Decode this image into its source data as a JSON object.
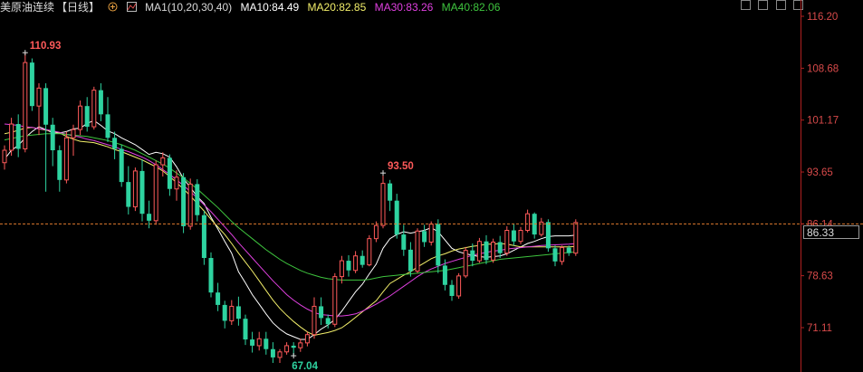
{
  "legend": {
    "title": "美原油连续",
    "period": "【日线】",
    "ma_name": "MA1(10,20,30,40)",
    "ma10": "MA10:84.49",
    "ma20": "MA20:82.85",
    "ma30": "MA30:83.26",
    "ma40": "MA40:82.06"
  },
  "price_box": "86.33",
  "colors": {
    "background": "#000000",
    "up": "#ff5a5a",
    "down": "#2ed3a0",
    "ma10": "#ffffff",
    "ma20": "#f2ee6a",
    "ma30": "#e040e0",
    "ma40": "#3ec43e",
    "axis_text": "#d84a4a",
    "last_price_line": "#e07a2e"
  },
  "chart_data": {
    "type": "candlestick",
    "y_ticks": [
      "116.20",
      "108.68",
      "101.17",
      "93.65",
      "86.14",
      "78.63",
      "71.11"
    ],
    "ylim": [
      63.5,
      116.2
    ],
    "annotations": [
      {
        "text": "110.93",
        "value": 110.93,
        "index": 3
      },
      {
        "text": "93.50",
        "value": 93.5,
        "index": 55
      },
      {
        "text": "67.04",
        "value": 67.04,
        "index": 42
      }
    ],
    "last_price": 86.33,
    "candles": [
      [
        95.0,
        97.5,
        94.0,
        96.8
      ],
      [
        96.8,
        101.5,
        96.0,
        100.6
      ],
      [
        100.6,
        102.0,
        95.8,
        97.0
      ],
      [
        97.0,
        110.93,
        96.5,
        109.5
      ],
      [
        109.5,
        110.1,
        102.5,
        103.2
      ],
      [
        103.2,
        106.5,
        99.0,
        105.8
      ],
      [
        105.8,
        106.5,
        90.8,
        100.5
      ],
      [
        100.5,
        101.5,
        94.5,
        96.8
      ],
      [
        96.8,
        97.5,
        90.8,
        92.5
      ],
      [
        92.5,
        99.5,
        92.0,
        98.6
      ],
      [
        98.6,
        100.5,
        96.0,
        99.8
      ],
      [
        99.8,
        104.0,
        99.0,
        103.2
      ],
      [
        103.2,
        104.5,
        99.5,
        100.2
      ],
      [
        100.2,
        106.0,
        99.8,
        105.5
      ],
      [
        105.5,
        106.5,
        101.0,
        102.0
      ],
      [
        102.0,
        104.5,
        98.0,
        98.6
      ],
      [
        98.6,
        99.5,
        95.5,
        97.0
      ],
      [
        97.0,
        97.6,
        91.5,
        92.2
      ],
      [
        92.2,
        94.5,
        87.5,
        88.6
      ],
      [
        88.6,
        94.3,
        88.0,
        93.8
      ],
      [
        93.8,
        95.5,
        86.5,
        87.6
      ],
      [
        87.6,
        89.5,
        85.5,
        86.6
      ],
      [
        86.6,
        95.3,
        86.0,
        94.7
      ],
      [
        94.7,
        96.5,
        93.0,
        95.7
      ],
      [
        95.7,
        96.2,
        90.2,
        91.2
      ],
      [
        91.2,
        93.9,
        89.5,
        92.9
      ],
      [
        92.9,
        93.5,
        84.8,
        85.8
      ],
      [
        85.8,
        92.7,
        85.3,
        91.9
      ],
      [
        91.9,
        92.6,
        86.5,
        87.4
      ],
      [
        87.4,
        88.0,
        80.2,
        81.2
      ],
      [
        81.2,
        82.0,
        75.5,
        76.2
      ],
      [
        76.2,
        77.6,
        73.5,
        74.4
      ],
      [
        74.4,
        75.0,
        71.0,
        72.1
      ],
      [
        72.1,
        75.1,
        71.5,
        74.2
      ],
      [
        74.2,
        75.6,
        71.4,
        72.4
      ],
      [
        72.4,
        73.0,
        68.6,
        69.4
      ],
      [
        69.4,
        70.5,
        67.5,
        68.5
      ],
      [
        68.5,
        70.5,
        67.8,
        69.5
      ],
      [
        69.5,
        70.5,
        67.2,
        68.0
      ],
      [
        68.0,
        69.0,
        66.0,
        66.8
      ],
      [
        66.8,
        68.0,
        66.0,
        67.6
      ],
      [
        67.6,
        69.0,
        67.2,
        68.5
      ],
      [
        68.5,
        69.0,
        67.04,
        68.2
      ],
      [
        68.2,
        69.5,
        67.6,
        68.9
      ],
      [
        68.9,
        70.5,
        68.4,
        70.1
      ],
      [
        70.1,
        75.5,
        69.5,
        74.2
      ],
      [
        74.2,
        75.5,
        71.5,
        72.5
      ],
      [
        72.5,
        73.0,
        71.0,
        71.6
      ],
      [
        71.6,
        79.0,
        71.2,
        78.5
      ],
      [
        78.5,
        81.5,
        77.5,
        80.8
      ],
      [
        80.8,
        81.6,
        78.5,
        79.4
      ],
      [
        79.4,
        82.2,
        79.0,
        81.5
      ],
      [
        81.5,
        82.3,
        79.8,
        80.2
      ],
      [
        80.2,
        84.5,
        80.0,
        84.0
      ],
      [
        84.0,
        86.5,
        83.5,
        85.9
      ],
      [
        85.9,
        93.5,
        85.5,
        92.0
      ],
      [
        92.0,
        92.5,
        88.0,
        89.5
      ],
      [
        89.5,
        90.5,
        84.0,
        84.6
      ],
      [
        84.6,
        86.0,
        81.5,
        82.4
      ],
      [
        82.4,
        83.5,
        78.5,
        79.3
      ],
      [
        79.3,
        85.5,
        79.0,
        85.1
      ],
      [
        85.1,
        86.0,
        82.8,
        83.5
      ],
      [
        83.5,
        86.5,
        83.0,
        86.1
      ],
      [
        86.1,
        86.8,
        79.0,
        80.1
      ],
      [
        80.1,
        81.0,
        76.5,
        77.3
      ],
      [
        77.3,
        78.0,
        75.0,
        75.7
      ],
      [
        75.7,
        79.0,
        75.3,
        78.6
      ],
      [
        78.6,
        82.8,
        78.3,
        82.3
      ],
      [
        82.3,
        83.3,
        80.0,
        80.8
      ],
      [
        80.8,
        84.1,
        80.5,
        83.6
      ],
      [
        83.6,
        84.5,
        80.3,
        80.9
      ],
      [
        80.9,
        84.0,
        80.5,
        83.5
      ],
      [
        83.5,
        84.4,
        81.2,
        81.9
      ],
      [
        81.9,
        85.8,
        81.5,
        85.2
      ],
      [
        85.2,
        86.2,
        83.0,
        83.6
      ],
      [
        83.6,
        85.7,
        83.2,
        85.2
      ],
      [
        85.2,
        88.2,
        84.9,
        87.6
      ],
      [
        87.6,
        87.8,
        84.0,
        84.6
      ],
      [
        84.6,
        87.0,
        84.3,
        86.4
      ],
      [
        86.4,
        86.8,
        82.1,
        82.6
      ],
      [
        82.6,
        83.0,
        80.0,
        80.7
      ],
      [
        80.7,
        83.0,
        80.2,
        82.7
      ],
      [
        82.7,
        83.0,
        81.5,
        81.9
      ],
      [
        81.9,
        86.8,
        81.5,
        86.33
      ]
    ],
    "ma_lines": [
      {
        "name": "MA10",
        "values": [
          95.5,
          96.8,
          97.5,
          98.6,
          99.5,
          100.2,
          99.8,
          99.3,
          99.3,
          99.5,
          99.9,
          100.0,
          100.7,
          101.1,
          100.4,
          99.6,
          99.2,
          98.6,
          98.1,
          97.6,
          96.9,
          96.2,
          96.5,
          96.3,
          95.8,
          94.4,
          92.7,
          91.4,
          90.1,
          89.1,
          87.1,
          85.4,
          83.6,
          81.9,
          79.2,
          77.6,
          75.9,
          74.5,
          73.1,
          71.8,
          70.9,
          70.2,
          69.8,
          69.4,
          69.4,
          70.1,
          70.9,
          71.5,
          72.3,
          73.5,
          74.9,
          76.3,
          77.4,
          78.9,
          80.3,
          82.6,
          84.0,
          84.6,
          85.0,
          84.8,
          85.0,
          85.2,
          85.6,
          85.0,
          83.8,
          82.6,
          82.1,
          81.8,
          81.6,
          81.4,
          81.3,
          81.4,
          81.5,
          81.8,
          82.3,
          82.8,
          83.3,
          83.6,
          84.0,
          84.3,
          84.4,
          84.4,
          84.4,
          84.5
        ]
      },
      {
        "name": "MA20",
        "values": [
          99.2,
          99.4,
          99.7,
          100.0,
          100.1,
          99.9,
          99.7,
          99.6,
          99.3,
          98.8,
          98.4,
          98.1,
          98.0,
          97.9,
          97.6,
          97.3,
          96.9,
          96.6,
          96.2,
          95.8,
          95.4,
          94.9,
          94.4,
          93.8,
          93.0,
          92.1,
          91.2,
          90.2,
          89.1,
          88.0,
          86.8,
          85.7,
          84.6,
          83.3,
          81.9,
          80.6,
          79.3,
          77.9,
          76.5,
          75.1,
          73.9,
          72.9,
          72.0,
          71.2,
          70.5,
          70.0,
          70.2,
          70.4,
          70.7,
          71.1,
          71.8,
          72.6,
          73.4,
          74.2,
          75.0,
          76.3,
          77.5,
          78.1,
          78.7,
          79.2,
          79.9,
          80.5,
          81.1,
          81.5,
          81.8,
          82.2,
          82.5,
          82.7,
          82.9,
          83.0,
          83.2,
          83.2,
          83.3,
          83.2,
          83.0,
          82.8,
          82.8,
          82.8,
          82.8,
          82.8,
          82.8,
          82.8,
          82.8,
          82.85
        ]
      },
      {
        "name": "MA30",
        "values": [
          100.6,
          100.5,
          100.4,
          100.2,
          100.1,
          99.9,
          99.8,
          99.6,
          99.4,
          99.1,
          98.9,
          98.7,
          98.4,
          98.2,
          97.9,
          97.6,
          97.3,
          96.9,
          96.6,
          96.2,
          95.8,
          95.3,
          94.7,
          94.0,
          93.3,
          92.5,
          91.7,
          90.8,
          89.9,
          88.9,
          87.9,
          86.8,
          85.7,
          84.6,
          83.4,
          82.3,
          81.2,
          80.1,
          79.0,
          77.9,
          76.9,
          75.9,
          75.1,
          74.4,
          73.8,
          73.3,
          73.0,
          72.9,
          72.8,
          72.8,
          72.9,
          73.1,
          73.5,
          74.0,
          74.5,
          75.1,
          75.7,
          76.4,
          77.1,
          77.8,
          78.5,
          79.1,
          79.6,
          80.0,
          80.4,
          80.7,
          81.0,
          81.3,
          81.6,
          81.8,
          82.0,
          82.2,
          82.3,
          82.5,
          82.6,
          82.7,
          82.8,
          82.9,
          83.0,
          83.05,
          83.1,
          83.15,
          83.2,
          83.26
        ]
      },
      {
        "name": "MA40",
        "values": [
          98.3,
          98.5,
          98.7,
          98.9,
          99.0,
          99.1,
          99.2,
          99.2,
          99.2,
          99.1,
          99.0,
          98.9,
          98.8,
          98.6,
          98.4,
          98.2,
          97.9,
          97.6,
          97.2,
          96.8,
          96.3,
          95.8,
          95.3,
          94.8,
          94.2,
          93.5,
          92.8,
          92.0,
          91.2,
          90.3,
          89.4,
          88.5,
          87.5,
          86.5,
          85.6,
          84.8,
          84.0,
          83.2,
          82.4,
          81.7,
          81.0,
          80.4,
          79.9,
          79.4,
          79.0,
          78.7,
          78.4,
          78.2,
          78.1,
          78.0,
          78.0,
          78.0,
          78.0,
          78.1,
          78.3,
          78.5,
          78.6,
          78.7,
          78.8,
          78.9,
          79.0,
          79.1,
          79.2,
          79.3,
          79.4,
          79.6,
          79.8,
          80.0,
          80.2,
          80.4,
          80.6,
          80.8,
          81.0,
          81.1,
          81.2,
          81.3,
          81.4,
          81.5,
          81.6,
          81.7,
          81.8,
          81.9,
          82.0,
          82.06
        ]
      }
    ]
  }
}
